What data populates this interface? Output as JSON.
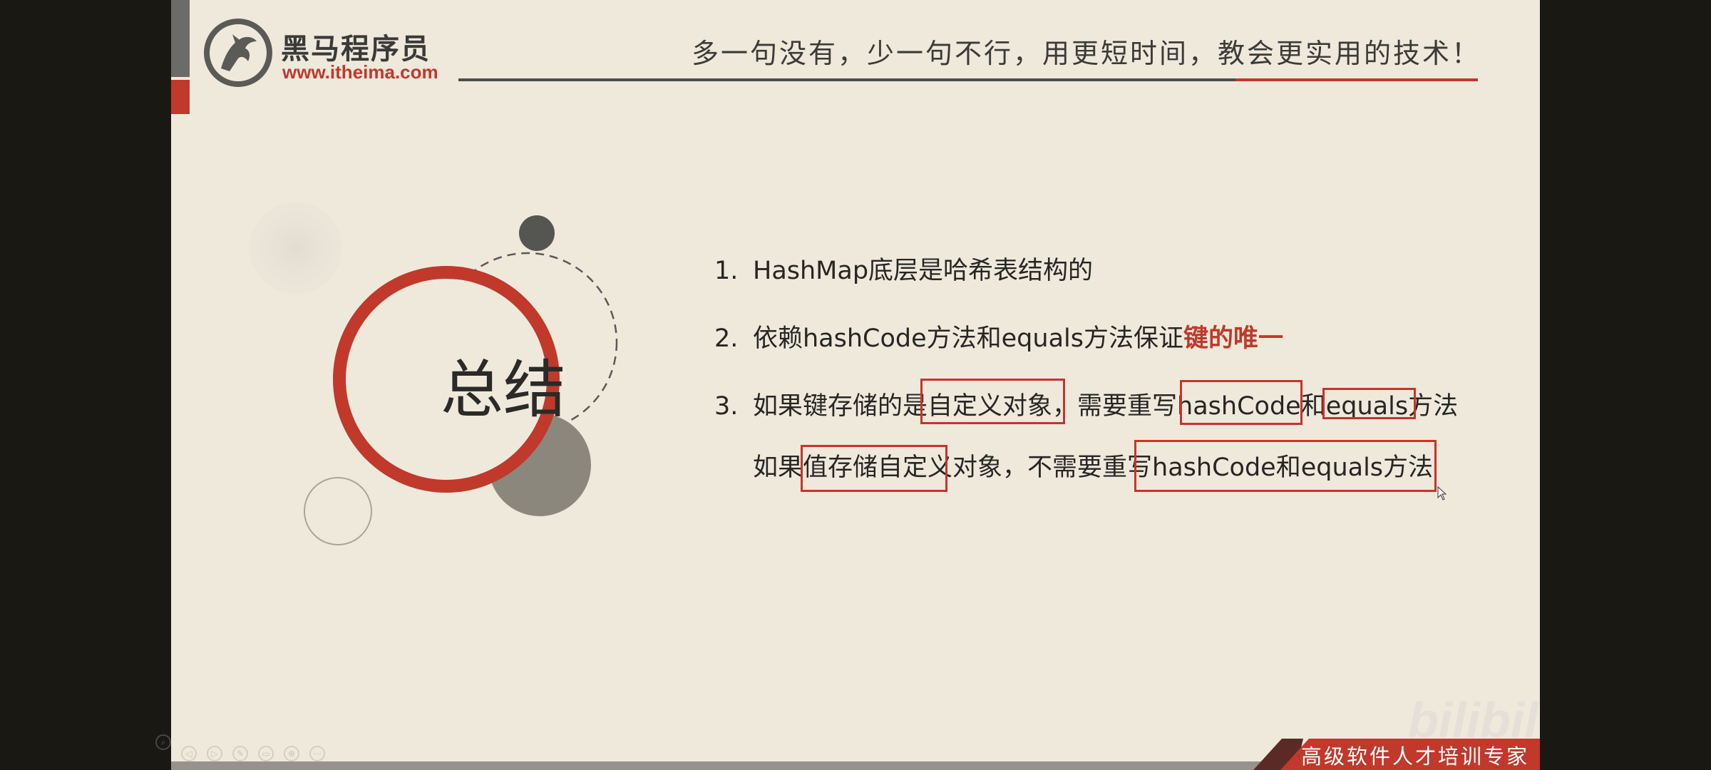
{
  "header": {
    "brand": "黑马程序员",
    "url": "www.itheima.com",
    "slogan": "多一句没有，少一句不行，用更短时间，教会更实用的技术！"
  },
  "title": "总结",
  "points": [
    {
      "num": "1.",
      "text": "HashMap底层是哈希表结构的"
    },
    {
      "num": "2.",
      "text": "依赖hashCode方法和equals方法保证",
      "emphasis": "键的唯一"
    },
    {
      "num": "3.",
      "pre": "如果键存储的是",
      "box1": "自定义对象",
      "mid1": "，需要重写",
      "box2": "hashCode",
      "mid2": "和",
      "box3": "equals",
      "post": "方法"
    },
    {
      "pre": "如果",
      "box1": "值存储自定义对象",
      "mid1": "，不需要重写",
      "box2": "hashCode和equals方法"
    }
  ],
  "footer": {
    "tagline": "高级软件人才培训专家",
    "watermark": "bilibili"
  },
  "colors": {
    "accent": "#c0392b",
    "slide_bg": "#efe9dc",
    "frame_bg": "#1a1813"
  },
  "controls": [
    "prev-icon",
    "play-icon",
    "pen-icon",
    "slides-icon",
    "zoom-icon",
    "more-icon"
  ]
}
